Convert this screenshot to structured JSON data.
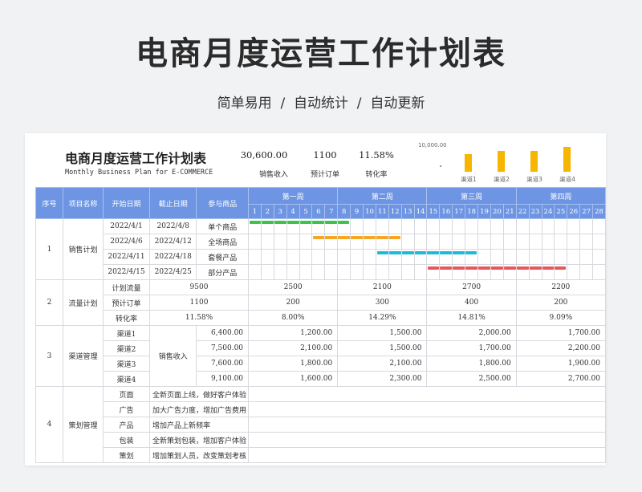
{
  "page": {
    "hero_title": "电商月度运营工作计划表",
    "hero_subtitle": "简单易用  /  自动统计  /  自动更新"
  },
  "sheet": {
    "title": "电商月度运营工作计划表",
    "subtitle_en": "Monthly Business Plan for E-COMMERCE",
    "kpis": [
      {
        "value": "30,600.00",
        "label": "销售收入"
      },
      {
        "value": "1100",
        "label": "预计订单"
      },
      {
        "value": "11.58%",
        "label": "转化率"
      }
    ],
    "mini_chart": {
      "max_label": "10,000.00",
      "bars": [
        {
          "label": "渠道1",
          "value": 6400
        },
        {
          "label": "渠道2",
          "value": 7500
        },
        {
          "label": "渠道3",
          "value": 7600
        },
        {
          "label": "渠道4",
          "value": 9100
        }
      ]
    },
    "headers": [
      "序号",
      "项目名称",
      "开始日期",
      "截止日期",
      "参与商品"
    ],
    "weeks": [
      "第一周",
      "第二周",
      "第三周",
      "第四周"
    ],
    "days": [
      "1",
      "2",
      "3",
      "4",
      "5",
      "6",
      "7",
      "8",
      "9",
      "10",
      "11",
      "12",
      "13",
      "14",
      "15",
      "16",
      "17",
      "18",
      "19",
      "20",
      "21",
      "22",
      "23",
      "24",
      "25",
      "26",
      "27",
      "28"
    ],
    "sales_plan": {
      "index": "1",
      "name": "销售计划",
      "rows": [
        {
          "start": "2022/4/1",
          "end": "2022/4/8",
          "product": "单个商品",
          "bar_from": 1,
          "bar_to": 8,
          "color": "#3dc24a"
        },
        {
          "start": "2022/4/6",
          "end": "2022/4/12",
          "product": "全场商品",
          "bar_from": 6,
          "bar_to": 12,
          "color": "#f5a623"
        },
        {
          "start": "2022/4/11",
          "end": "2022/4/18",
          "product": "套餐产品",
          "bar_from": 11,
          "bar_to": 18,
          "color": "#1fbad6"
        },
        {
          "start": "2022/4/15",
          "end": "2022/4/25",
          "product": "部分产品",
          "bar_from": 15,
          "bar_to": 25,
          "color": "#e8575b"
        }
      ]
    },
    "traffic_plan": {
      "index": "2",
      "name": "流量计划",
      "rows": [
        {
          "label": "计划流量",
          "total": "9500",
          "weeks": [
            "2500",
            "2100",
            "2700",
            "2200"
          ]
        },
        {
          "label": "预计订单",
          "total": "1100",
          "weeks": [
            "200",
            "300",
            "400",
            "200"
          ]
        },
        {
          "label": "转化率",
          "total": "11.58%",
          "weeks": [
            "8.00%",
            "14.29%",
            "14.81%",
            "9.09%"
          ]
        }
      ]
    },
    "channel_mgmt": {
      "index": "3",
      "name": "渠道管理",
      "metric": "销售收入",
      "rows": [
        {
          "label": "渠道1",
          "total": "6,400.00",
          "weeks": [
            "1,200.00",
            "1,500.00",
            "2,000.00",
            "1,700.00"
          ]
        },
        {
          "label": "渠道2",
          "total": "7,500.00",
          "weeks": [
            "2,100.00",
            "1,500.00",
            "1,700.00",
            "2,200.00"
          ]
        },
        {
          "label": "渠道3",
          "total": "7,600.00",
          "weeks": [
            "1,800.00",
            "2,100.00",
            "1,800.00",
            "1,900.00"
          ]
        },
        {
          "label": "渠道4",
          "total": "9,100.00",
          "weeks": [
            "1,600.00",
            "2,300.00",
            "2,500.00",
            "2,700.00"
          ]
        }
      ]
    },
    "planning_mgmt": {
      "index": "4",
      "name": "策划管理",
      "rows": [
        {
          "label": "页面",
          "desc": "全新页面上线，做好客户体验"
        },
        {
          "label": "广告",
          "desc": "加大广告力度，增加广告费用"
        },
        {
          "label": "产品",
          "desc": "增加产品上新频率"
        },
        {
          "label": "包装",
          "desc": "全新策划包装，增加客户体验"
        },
        {
          "label": "策划",
          "desc": "增加策划人员，改变策划考核"
        }
      ]
    }
  }
}
